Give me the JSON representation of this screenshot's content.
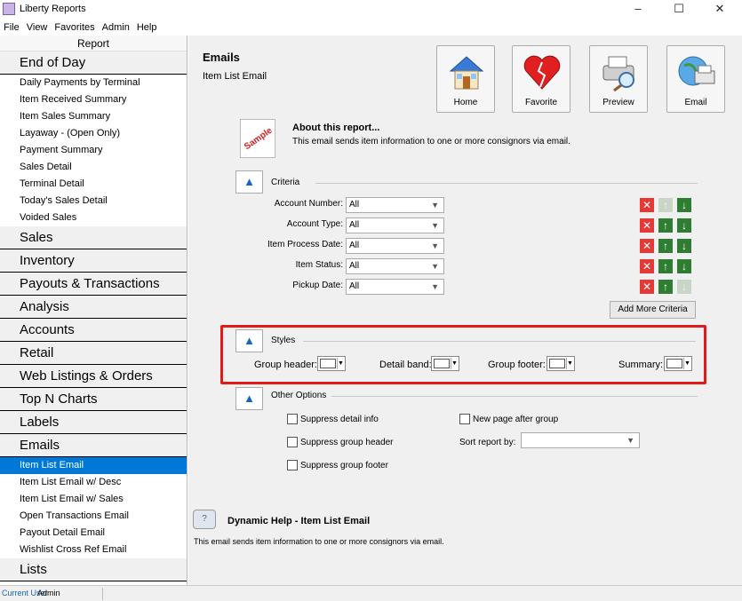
{
  "window": {
    "title": "Liberty Reports",
    "min": "–",
    "max": "☐",
    "close": "✕"
  },
  "menu": [
    "File",
    "View",
    "Favorites",
    "Admin",
    "Help"
  ],
  "sidebar": {
    "header": "Report",
    "groups": [
      {
        "label": "End of Day",
        "items": [
          "Daily Payments by Terminal",
          "Item Received Summary",
          "Item Sales Summary",
          "Layaway - (Open Only)",
          "Payment Summary",
          "Sales Detail",
          "Terminal Detail",
          "Today's Sales Detail",
          "Voided Sales"
        ]
      },
      {
        "label": "Sales",
        "items": []
      },
      {
        "label": "Inventory",
        "items": []
      },
      {
        "label": "Payouts & Transactions",
        "items": []
      },
      {
        "label": "Analysis",
        "items": []
      },
      {
        "label": "Accounts",
        "items": []
      },
      {
        "label": "Retail",
        "items": []
      },
      {
        "label": "Web Listings & Orders",
        "items": []
      },
      {
        "label": "Top N Charts",
        "items": []
      },
      {
        "label": "Labels",
        "items": []
      },
      {
        "label": "Emails",
        "items": [
          "Item List Email",
          "Item List Email w/ Desc",
          "Item List Email w/ Sales",
          "Open Transactions Email",
          "Payout Detail Email",
          "Wishlist Cross Ref Email"
        ]
      },
      {
        "label": "Lists",
        "items": []
      }
    ],
    "active_item": "Item List Email"
  },
  "main": {
    "title": "Emails",
    "subtitle": "Item List Email",
    "toolbar": [
      {
        "label": "Home",
        "icon": "home-icon"
      },
      {
        "label": "Favorite",
        "icon": "favorite-icon"
      },
      {
        "label": "Preview",
        "icon": "preview-icon"
      },
      {
        "label": "Email",
        "icon": "email-icon"
      }
    ],
    "about": {
      "title": "About this report...",
      "desc": "This email sends item information to one or more consignors via email.",
      "icon_text": "Sample"
    },
    "criteria": {
      "label": "Criteria",
      "rows": [
        {
          "label": "Account Number:",
          "value": "All"
        },
        {
          "label": "Account Type:",
          "value": "All"
        },
        {
          "label": "Item Process Date:",
          "value": "All"
        },
        {
          "label": "Item Status:",
          "value": "All"
        },
        {
          "label": "Pickup Date:",
          "value": "All"
        }
      ],
      "add_button": "Add More Criteria"
    },
    "styles": {
      "label": "Styles",
      "group_header": "Group header:",
      "detail_band": "Detail band:",
      "group_footer": "Group footer:",
      "summary": "Summary:"
    },
    "other": {
      "label": "Other Options",
      "suppress_detail": "Suppress detail info",
      "suppress_group_header": "Suppress group header",
      "suppress_group_footer": "Suppress group footer",
      "new_page": "New page after group",
      "sort_label": "Sort report by:",
      "sort_value": ""
    },
    "help": {
      "title": "Dynamic Help - Item List Email",
      "desc": "This email sends item information to one or more consignors via email.",
      "icon_text": "?"
    }
  },
  "status": {
    "label": "Current User",
    "value": "Admin"
  },
  "colors": {
    "accent": "#0078d7",
    "highlight_border": "#e01b1b",
    "delete": "#e53935",
    "move": "#2e7d32"
  }
}
